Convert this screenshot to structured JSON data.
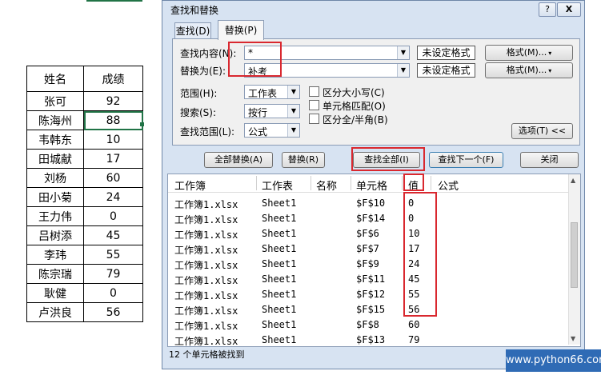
{
  "sheet": {
    "headers": [
      "姓名",
      "成绩"
    ],
    "rows": [
      [
        "张可",
        "92"
      ],
      [
        "陈海州",
        "88"
      ],
      [
        "韦韩东",
        "10"
      ],
      [
        "田城献",
        "17"
      ],
      [
        "刘杨",
        "60"
      ],
      [
        "田小菊",
        "24"
      ],
      [
        "王力伟",
        "0"
      ],
      [
        "吕树添",
        "45"
      ],
      [
        "李玮",
        "55"
      ],
      [
        "陈宗瑞",
        "79"
      ],
      [
        "耿健",
        "0"
      ],
      [
        "卢洪良",
        "56"
      ]
    ]
  },
  "dialog": {
    "title": "查找和替换",
    "help_label": "?",
    "close_label": "X",
    "tabs": {
      "find": "查找(D)",
      "replace": "替换(P)"
    },
    "find_label": "查找内容(N):",
    "find_value": "*",
    "replace_label": "替换为(E):",
    "replace_value": "补考",
    "no_format": "未设定格式",
    "format_button": "格式(M)...",
    "scope_label": "范围(H):",
    "scope_value": "工作表",
    "search_label": "搜索(S):",
    "search_value": "按行",
    "lookin_label": "查找范围(L):",
    "lookin_value": "公式",
    "checks": {
      "match_case": "区分大小写(C)",
      "match_cell": "单元格匹配(O)",
      "match_width": "区分全/半角(B)"
    },
    "options_button": "选项(T) <<",
    "buttons": {
      "replace_all": "全部替换(A)",
      "replace": "替换(R)",
      "find_all": "查找全部(I)",
      "find_next": "查找下一个(F)",
      "close": "关闭"
    },
    "columns": [
      "工作簿",
      "工作表",
      "名称",
      "单元格",
      "值",
      "公式"
    ],
    "results": [
      [
        "工作簿1.xlsx",
        "Sheet1",
        "$F$10",
        "0"
      ],
      [
        "工作簿1.xlsx",
        "Sheet1",
        "$F$14",
        "0"
      ],
      [
        "工作簿1.xlsx",
        "Sheet1",
        "$F$6",
        "10"
      ],
      [
        "工作簿1.xlsx",
        "Sheet1",
        "$F$7",
        "17"
      ],
      [
        "工作簿1.xlsx",
        "Sheet1",
        "$F$9",
        "24"
      ],
      [
        "工作簿1.xlsx",
        "Sheet1",
        "$F$11",
        "45"
      ],
      [
        "工作簿1.xlsx",
        "Sheet1",
        "$F$12",
        "55"
      ],
      [
        "工作簿1.xlsx",
        "Sheet1",
        "$F$15",
        "56"
      ],
      [
        "工作簿1.xlsx",
        "Sheet1",
        "$F$8",
        "60"
      ],
      [
        "工作簿1.xlsx",
        "Sheet1",
        "$F$13",
        "79"
      ]
    ],
    "status": "12 个单元格被找到"
  },
  "watermark": "www.python66.com",
  "colors": {
    "highlight": "#d9282f",
    "dialog_bg": "#d7e3f2",
    "watermark_bg": "#2f6bb5"
  }
}
